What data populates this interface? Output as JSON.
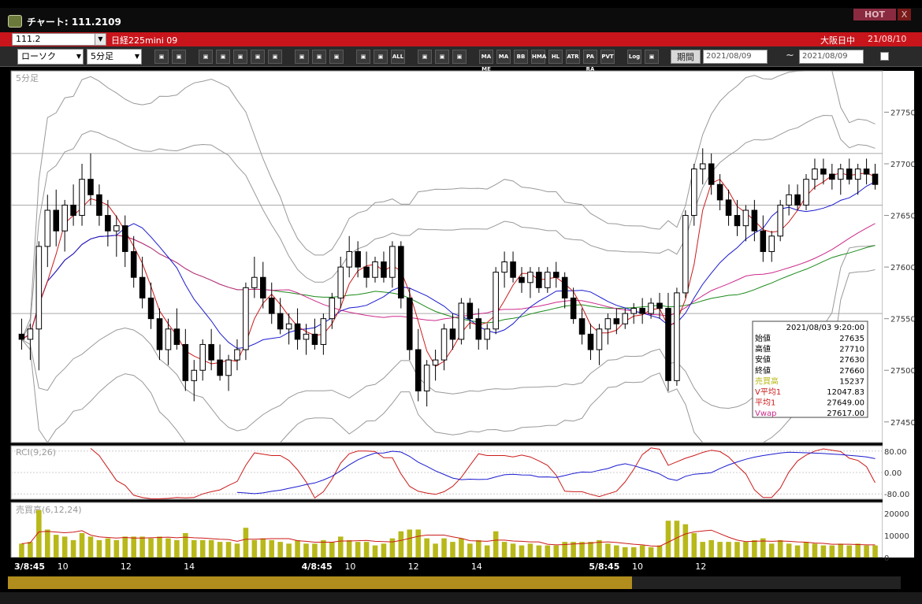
{
  "window": {
    "title": "チャート: 111.2109",
    "hot_label": "HOT",
    "close_label": "X"
  },
  "symbol_bar": {
    "code": "111.2",
    "name": "日経225mini 09",
    "market": "大阪日中",
    "date": "21/08/10"
  },
  "toolbar": {
    "chart_type": "ローソク",
    "interval": "5分足",
    "period_label": "期間",
    "date_from": "2021/08/09",
    "date_to": "2021/08/09",
    "tilde": "~",
    "buttons": [
      "zoom",
      "bars",
      "line-up",
      "zoom-in",
      "chart",
      "cross",
      "erase",
      "pencil",
      "cursor",
      "arrow",
      "candle",
      "candle2",
      "ALL",
      "shape",
      "brush",
      "color",
      "MA/ME",
      "MA",
      "BB",
      "HMA",
      "HL",
      "ATR",
      "PARA",
      "PVT",
      "Log",
      "grid"
    ],
    "button_labels": {
      "all": "ALL",
      "mame": "MA ME",
      "ma": "MA",
      "bb": "BB",
      "hma": "HMA",
      "hl": "HL",
      "atr": "ATR",
      "para": "PA RA",
      "pvt": "PVT",
      "log": "Log"
    }
  },
  "colors": {
    "up": "#ffffff",
    "down": "#000000",
    "bg": "#ffffff",
    "ma1": "#cc1a1a",
    "ma2": "#1a1ad0",
    "ma3": "#1a8a1a",
    "vwap": "#cc2a8a",
    "bb": "#999999",
    "rci_fast": "#cc1a1a",
    "rci_slow": "#1a1ad0",
    "volume": "#b8b81a"
  },
  "chart_data": {
    "type": "candlestick",
    "main_panel": {
      "label": "5分足",
      "y_ticks": [
        27750,
        27700,
        27650,
        27600,
        27550,
        27500,
        27450
      ],
      "ylim": [
        27430,
        27790
      ],
      "hlines": [
        27710,
        27660,
        27555
      ],
      "candles": [
        [
          27535,
          27550,
          27520,
          27530
        ],
        [
          27530,
          27545,
          27510,
          27540
        ],
        [
          27540,
          27625,
          27500,
          27620
        ],
        [
          27620,
          27670,
          27600,
          27655
        ],
        [
          27655,
          27675,
          27620,
          27635
        ],
        [
          27635,
          27665,
          27615,
          27660
        ],
        [
          27660,
          27680,
          27640,
          27650
        ],
        [
          27650,
          27700,
          27640,
          27685
        ],
        [
          27685,
          27710,
          27660,
          27670
        ],
        [
          27670,
          27680,
          27640,
          27650
        ],
        [
          27650,
          27665,
          27620,
          27635
        ],
        [
          27635,
          27650,
          27610,
          27640
        ],
        [
          27640,
          27650,
          27600,
          27615
        ],
        [
          27615,
          27630,
          27580,
          27590
        ],
        [
          27590,
          27610,
          27560,
          27570
        ],
        [
          27570,
          27585,
          27540,
          27550
        ],
        [
          27550,
          27560,
          27510,
          27520
        ],
        [
          27520,
          27550,
          27505,
          27540
        ],
        [
          27540,
          27560,
          27520,
          27525
        ],
        [
          27525,
          27540,
          27480,
          27490
        ],
        [
          27490,
          27510,
          27470,
          27500
        ],
        [
          27500,
          27530,
          27490,
          27525
        ],
        [
          27525,
          27540,
          27500,
          27510
        ],
        [
          27510,
          27525,
          27490,
          27495
        ],
        [
          27495,
          27515,
          27480,
          27510
        ],
        [
          27510,
          27530,
          27500,
          27520
        ],
        [
          27520,
          27585,
          27510,
          27580
        ],
        [
          27580,
          27610,
          27570,
          27590
        ],
        [
          27590,
          27605,
          27560,
          27570
        ],
        [
          27570,
          27585,
          27545,
          27555
        ],
        [
          27555,
          27570,
          27535,
          27540
        ],
        [
          27540,
          27555,
          27525,
          27545
        ],
        [
          27545,
          27560,
          27520,
          27530
        ],
        [
          27530,
          27545,
          27515,
          27535
        ],
        [
          27535,
          27550,
          27520,
          27525
        ],
        [
          27525,
          27555,
          27515,
          27550
        ],
        [
          27550,
          27575,
          27540,
          27570
        ],
        [
          27570,
          27610,
          27560,
          27600
        ],
        [
          27600,
          27630,
          27590,
          27615
        ],
        [
          27615,
          27625,
          27590,
          27600
        ],
        [
          27600,
          27615,
          27580,
          27590
        ],
        [
          27590,
          27610,
          27585,
          27605
        ],
        [
          27605,
          27615,
          27585,
          27590
        ],
        [
          27590,
          27625,
          27580,
          27620
        ],
        [
          27620,
          27625,
          27560,
          27570
        ],
        [
          27570,
          27580,
          27510,
          27520
        ],
        [
          27520,
          27540,
          27470,
          27480
        ],
        [
          27480,
          27510,
          27465,
          27505
        ],
        [
          27505,
          27520,
          27490,
          27510
        ],
        [
          27510,
          27545,
          27500,
          27540
        ],
        [
          27540,
          27555,
          27520,
          27530
        ],
        [
          27530,
          27570,
          27525,
          27565
        ],
        [
          27565,
          27570,
          27540,
          27550
        ],
        [
          27550,
          27560,
          27520,
          27530
        ],
        [
          27530,
          27545,
          27520,
          27540
        ],
        [
          27540,
          27600,
          27535,
          27595
        ],
        [
          27595,
          27615,
          27580,
          27605
        ],
        [
          27605,
          27615,
          27585,
          27590
        ],
        [
          27590,
          27600,
          27575,
          27585
        ],
        [
          27585,
          27600,
          27570,
          27595
        ],
        [
          27595,
          27600,
          27575,
          27580
        ],
        [
          27580,
          27600,
          27575,
          27595
        ],
        [
          27595,
          27605,
          27580,
          27590
        ],
        [
          27590,
          27595,
          27560,
          27570
        ],
        [
          27570,
          27580,
          27545,
          27550
        ],
        [
          27550,
          27560,
          27525,
          27535
        ],
        [
          27535,
          27545,
          27510,
          27520
        ],
        [
          27520,
          27545,
          27505,
          27540
        ],
        [
          27540,
          27555,
          27525,
          27550
        ],
        [
          27550,
          27560,
          27535,
          27545
        ],
        [
          27545,
          27560,
          27540,
          27555
        ],
        [
          27555,
          27565,
          27545,
          27560
        ],
        [
          27560,
          27570,
          27545,
          27555
        ],
        [
          27555,
          27570,
          27550,
          27565
        ],
        [
          27565,
          27575,
          27550,
          27560
        ],
        [
          27560,
          27575,
          27480,
          27490
        ],
        [
          27490,
          27580,
          27485,
          27575
        ],
        [
          27575,
          27655,
          27570,
          27650
        ],
        [
          27650,
          27700,
          27640,
          27695
        ],
        [
          27695,
          27715,
          27680,
          27700
        ],
        [
          27700,
          27710,
          27670,
          27680
        ],
        [
          27680,
          27690,
          27655,
          27665
        ],
        [
          27665,
          27675,
          27640,
          27650
        ],
        [
          27650,
          27665,
          27630,
          27640
        ],
        [
          27640,
          27660,
          27625,
          27655
        ],
        [
          27655,
          27665,
          27625,
          27635
        ],
        [
          27635,
          27650,
          27605,
          27615
        ],
        [
          27615,
          27635,
          27605,
          27630
        ],
        [
          27630,
          27665,
          27625,
          27660
        ],
        [
          27660,
          27680,
          27650,
          27670
        ],
        [
          27670,
          27680,
          27655,
          27660
        ],
        [
          27660,
          27690,
          27655,
          27685
        ],
        [
          27685,
          27705,
          27675,
          27695
        ],
        [
          27695,
          27705,
          27680,
          27690
        ],
        [
          27690,
          27700,
          27675,
          27685
        ],
        [
          27685,
          27700,
          27670,
          27695
        ],
        [
          27695,
          27705,
          27680,
          27685
        ],
        [
          27685,
          27700,
          27670,
          27695
        ],
        [
          27695,
          27705,
          27680,
          27690
        ],
        [
          27690,
          27700,
          27675,
          27680
        ]
      ],
      "info_box": {
        "datetime": "2021/08/03 9:20:00",
        "rows": [
          {
            "label": "始値",
            "value": "27635",
            "color": "#000000"
          },
          {
            "label": "高値",
            "value": "27710",
            "color": "#000000"
          },
          {
            "label": "安値",
            "value": "27630",
            "color": "#000000"
          },
          {
            "label": "終値",
            "value": "27660",
            "color": "#000000"
          },
          {
            "label": "売買高",
            "value": "15237",
            "color": "#b8b81a"
          },
          {
            "label": "V平均1",
            "value": "12047.83",
            "color": "#cc1a1a"
          },
          {
            "label": "平均1",
            "value": "27649.00",
            "color": "#cc1a1a"
          },
          {
            "label": "Vwap",
            "value": "27617.00",
            "color": "#cc2a8a"
          }
        ]
      }
    },
    "rci_panel": {
      "label": "RCI(9,26)",
      "y_ticks": [
        "80.00",
        "0.00",
        "-80.00"
      ]
    },
    "volume_panel": {
      "label": "売買高(6,12,24)",
      "y_ticks": [
        "20000",
        "10000",
        "0"
      ]
    },
    "x_labels": [
      {
        "text": "3/8:45",
        "bold": true
      },
      {
        "text": "10",
        "bold": false
      },
      {
        "text": "12",
        "bold": false
      },
      {
        "text": "14",
        "bold": false
      },
      {
        "text": "4/8:45",
        "bold": true
      },
      {
        "text": "10",
        "bold": false
      },
      {
        "text": "12",
        "bold": false
      },
      {
        "text": "14",
        "bold": false
      },
      {
        "text": "5/8:45",
        "bold": true
      },
      {
        "text": "10",
        "bold": false
      },
      {
        "text": "12",
        "bold": false
      }
    ]
  }
}
